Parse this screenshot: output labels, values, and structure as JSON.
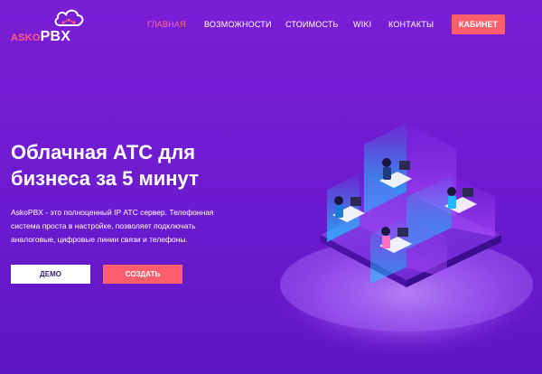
{
  "logo": {
    "part1": "ASKO",
    "part2": "PBX"
  },
  "nav": {
    "items": [
      {
        "label": "ГЛАВНАЯ",
        "active": true
      },
      {
        "label": "ВОЗМОЖНОСТИ",
        "active": false
      },
      {
        "label": "СТОИМОСТЬ",
        "active": false
      },
      {
        "label": "WIKI",
        "active": false
      },
      {
        "label": "КОНТАКТЫ",
        "active": false
      }
    ],
    "cabinet_label": "КАБИНЕТ"
  },
  "hero": {
    "title_line1": "Облачная АТС для",
    "title_line2": "бизнеса за 5 минут",
    "description": "AskoPBX - это полноценный IP АТС сервер. Телефонная система проста в настройке, позволяет подключать аналоговые, цифровые линии связи и телефоны.",
    "demo_label": "ДЕМО",
    "create_label": "СОЗДАТЬ"
  },
  "colors": {
    "accent": "#ff5f6d",
    "active_nav": "#ff6e8a",
    "background": "#7a1fd6"
  }
}
